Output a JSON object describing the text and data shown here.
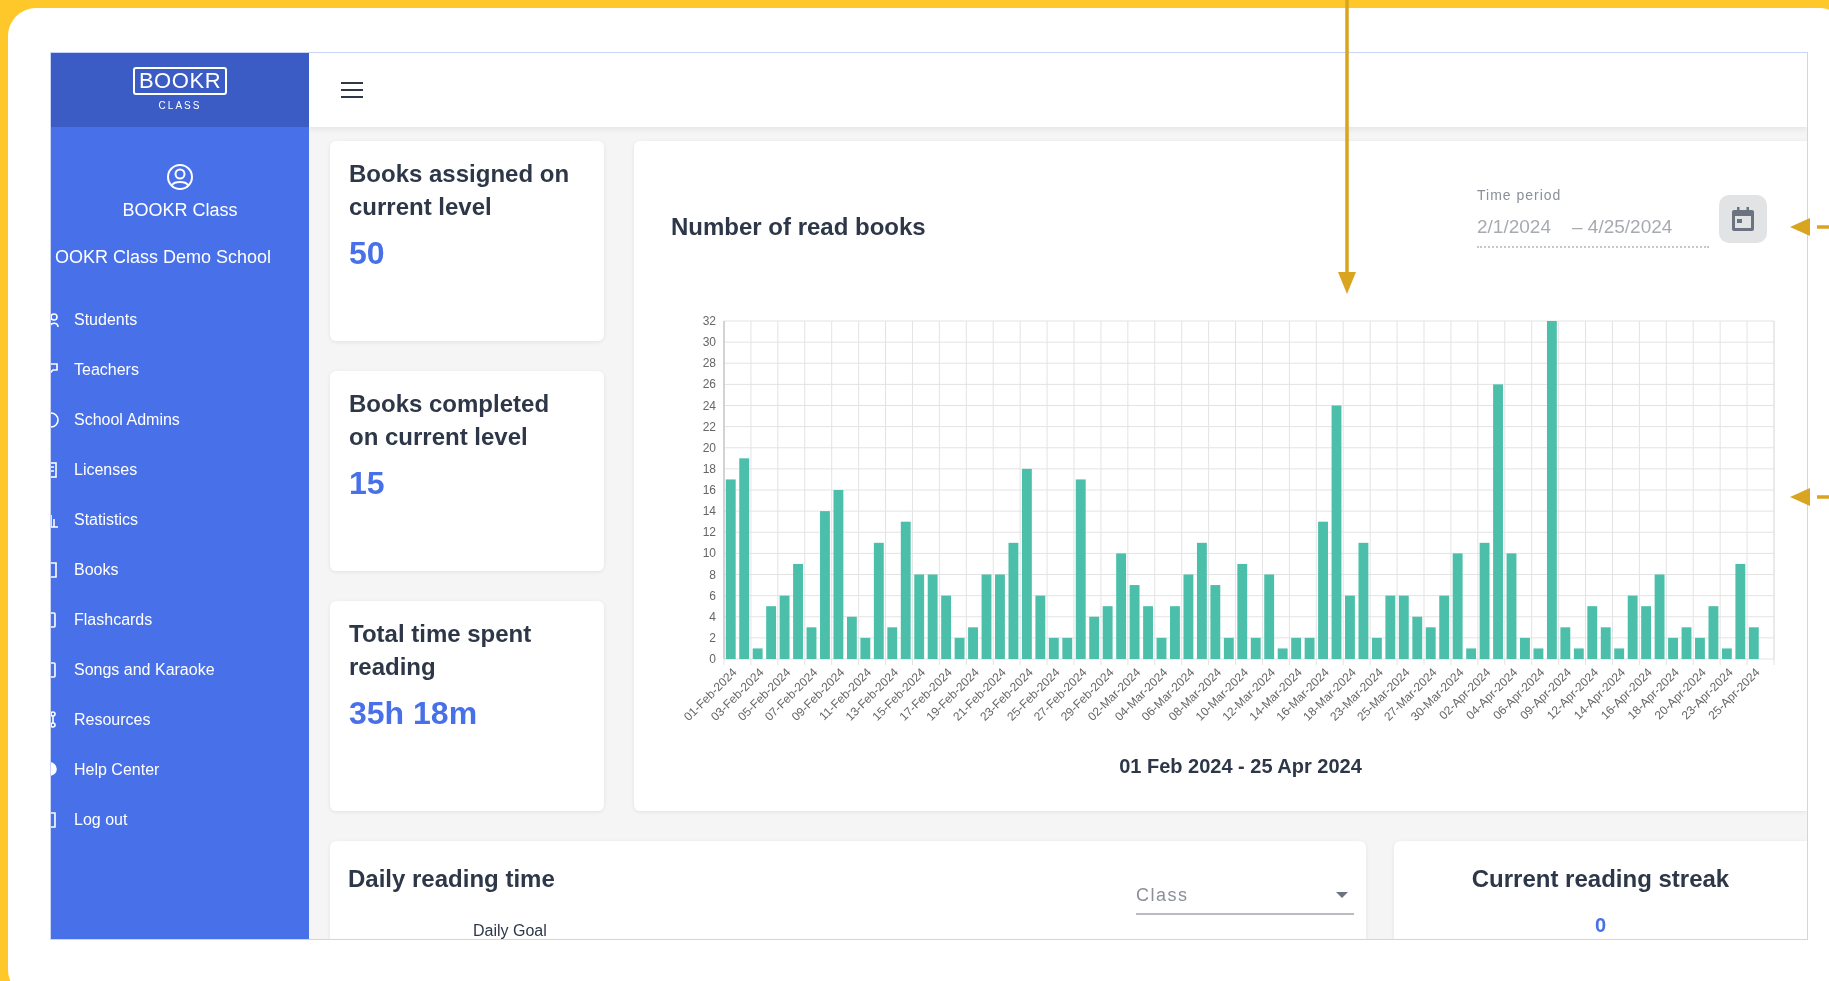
{
  "sidebar": {
    "logo": {
      "wordmark": "BOOKR",
      "subtitle": "CLASS"
    },
    "account_name": "BOOKR Class",
    "school_name": "OOKR Class Demo School",
    "items": [
      {
        "label": "Students"
      },
      {
        "label": "Teachers"
      },
      {
        "label": "School Admins"
      },
      {
        "label": "Licenses"
      },
      {
        "label": "Statistics"
      },
      {
        "label": "Books"
      },
      {
        "label": "Flashcards"
      },
      {
        "label": "Songs and Karaoke"
      },
      {
        "label": "Resources"
      },
      {
        "label": "Help Center"
      },
      {
        "label": "Log out"
      }
    ]
  },
  "stat_cards": [
    {
      "title": "Books assigned on current level",
      "value": "50"
    },
    {
      "title": "Books completed on current level",
      "value": "15"
    },
    {
      "title": "Total time spent reading",
      "value": "35h 18m"
    }
  ],
  "chart_panel": {
    "title": "Number of read books",
    "time_period": {
      "label": "Time period",
      "start": "2/1/2024",
      "end": "– 4/25/2024"
    },
    "chart_data": {
      "type": "bar",
      "xlabel": "01 Feb 2024 - 25 Apr 2024",
      "ylim": [
        0,
        32
      ],
      "yticks": [
        0,
        2,
        4,
        6,
        8,
        10,
        12,
        14,
        16,
        18,
        20,
        22,
        24,
        26,
        28,
        30,
        32
      ],
      "grid": true,
      "categories": [
        "01-Feb-2024",
        "03-Feb-2024",
        "05-Feb-2024",
        "07-Feb-2024",
        "09-Feb-2024",
        "11-Feb-2024",
        "13-Feb-2024",
        "15-Feb-2024",
        "17-Feb-2024",
        "19-Feb-2024",
        "21-Feb-2024",
        "23-Feb-2024",
        "25-Feb-2024",
        "27-Feb-2024",
        "29-Feb-2024",
        "02-Mar-2024",
        "04-Mar-2024",
        "06-Mar-2024",
        "08-Mar-2024",
        "10-Mar-2024",
        "12-Mar-2024",
        "14-Mar-2024",
        "16-Mar-2024",
        "18-Mar-2024",
        "23-Mar-2024",
        "25-Mar-2024",
        "27-Mar-2024",
        "30-Mar-2024",
        "02-Apr-2024",
        "04-Apr-2024",
        "06-Apr-2024",
        "09-Apr-2024",
        "12-Apr-2024",
        "14-Apr-2024",
        "16-Apr-2024",
        "18-Apr-2024",
        "20-Apr-2024",
        "23-Apr-2024",
        "25-Apr-2024"
      ],
      "series": [
        {
          "color": "#4bbfa9",
          "values": [
            17,
            1,
            6,
            3,
            16,
            2,
            3,
            8,
            6,
            3,
            8,
            18,
            2,
            17,
            5,
            7,
            2,
            8,
            7,
            9,
            8,
            2,
            13,
            6,
            2,
            6,
            3,
            10,
            11,
            10,
            1,
            3,
            5,
            1,
            5,
            2,
            2,
            1,
            3
          ]
        },
        {
          "color": "#4bbfa9",
          "values": [
            19,
            5,
            9,
            14,
            4,
            11,
            13,
            8,
            2,
            8,
            11,
            6,
            2,
            4,
            10,
            5,
            5,
            11,
            2,
            2,
            1,
            2,
            24,
            11,
            6,
            4,
            6,
            1,
            26,
            2,
            32,
            1,
            3,
            6,
            8,
            3,
            5,
            9,
            null
          ]
        }
      ]
    }
  },
  "daily_reading": {
    "title": "Daily reading time",
    "class_select": {
      "placeholder": "Class"
    },
    "legend": "Daily Goal"
  },
  "streak": {
    "title": "Current reading streak",
    "value": "0"
  }
}
